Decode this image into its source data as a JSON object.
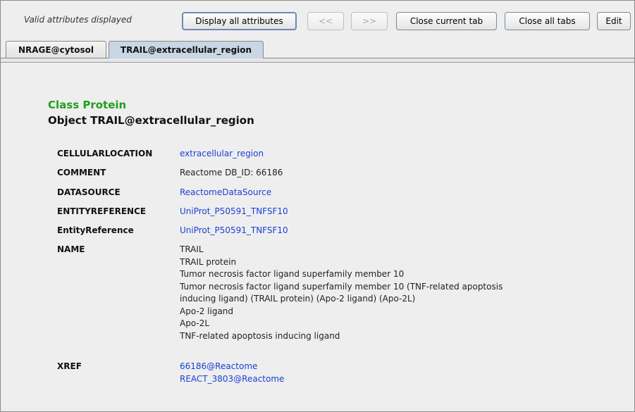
{
  "toolbar": {
    "status": "Valid attributes displayed",
    "display_all": "Display all attributes",
    "prev": "<<",
    "next": ">>",
    "close_current": "Close current tab",
    "close_all": "Close all tabs",
    "edit": "Edit"
  },
  "tabs": [
    {
      "label": "NRAGE@cytosol",
      "active": false
    },
    {
      "label": "TRAIL@extracellular_region",
      "active": true
    }
  ],
  "detail": {
    "class_label": "Class Protein",
    "object_label": "Object TRAIL@extracellular_region",
    "attributes": [
      {
        "name": "CELLULARLOCATION",
        "values": [
          "extracellular_region"
        ],
        "link": true
      },
      {
        "name": "COMMENT",
        "values": [
          "Reactome DB_ID: 66186"
        ],
        "link": false
      },
      {
        "name": "DATASOURCE",
        "values": [
          "ReactomeDataSource"
        ],
        "link": true
      },
      {
        "name": "ENTITYREFERENCE",
        "values": [
          "UniProt_P50591_TNFSF10"
        ],
        "link": true
      },
      {
        "name": "EntityReference",
        "values": [
          "UniProt_P50591_TNFSF10"
        ],
        "link": true
      },
      {
        "name": "NAME",
        "values": [
          "TRAIL",
          "TRAIL protein",
          "Tumor necrosis factor ligand superfamily member 10",
          "Tumor necrosis factor ligand superfamily member 10 (TNF-related apoptosis",
          "inducing ligand) (TRAIL protein) (Apo-2 ligand) (Apo-2L)",
          "Apo-2 ligand",
          "Apo-2L",
          "TNF-related apoptosis inducing ligand"
        ],
        "link": false
      },
      {
        "name": "XREF",
        "values": [
          "66186@Reactome",
          "REACT_3803@Reactome"
        ],
        "link": true
      }
    ]
  },
  "colors": {
    "class_label": "#1fa01f",
    "link": "#1a3fd6",
    "active_tab": "#c8d6e6"
  }
}
